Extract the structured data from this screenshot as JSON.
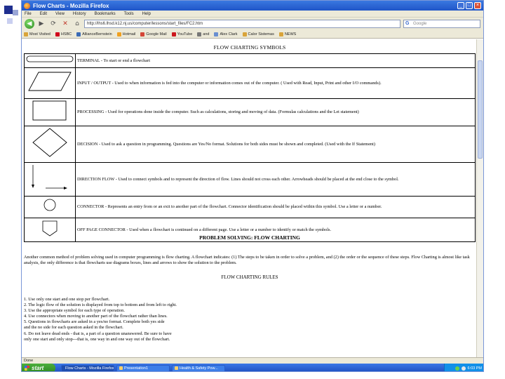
{
  "window": {
    "title": "Flow Charts - Mozilla Firefox",
    "minimize": "_",
    "maximize": "□",
    "close": "×"
  },
  "menu": [
    "File",
    "Edit",
    "View",
    "History",
    "Bookmarks",
    "Tools",
    "Help"
  ],
  "nav": {
    "back": "◀",
    "forward": "▶",
    "reload": "⟳",
    "stop": "✕",
    "home": "⌂",
    "url": "http://lhs6.lhsd.k12.nj.us/computer/lessons/start_files/FC2.htm",
    "search_placeholder": "Google",
    "search_engine_icon": "G"
  },
  "bookmarks": [
    {
      "label": "Most Visited",
      "color": "#d9a43a"
    },
    {
      "label": "HSBC",
      "color": "#d0021b"
    },
    {
      "label": "AllianceBernstein",
      "color": "#3b6bb5"
    },
    {
      "label": "Hotmail",
      "color": "#f0a020"
    },
    {
      "label": "Google Mail",
      "color": "#d44638"
    },
    {
      "label": "YouTube",
      "color": "#cc181e"
    },
    {
      "label": "and",
      "color": "#777777"
    },
    {
      "label": "Alex Clark",
      "color": "#6a8fd0"
    },
    {
      "label": "Calor Sistemas",
      "color": "#d9a43a"
    },
    {
      "label": "NEWS",
      "color": "#d9a43a"
    }
  ],
  "doc": {
    "title": "FLOW CHARTING SYMBOLS",
    "symbols": [
      {
        "shape": "terminal",
        "desc": "TERMINAL - To start or end a flowchart"
      },
      {
        "shape": "parallelogram",
        "desc": "INPUT / OUTPUT - Used to when information is fed into the computer or information comes out of the computer. ( Used with Read, Input, Print and other I/O commands)."
      },
      {
        "shape": "rectangle",
        "desc": "PROCESSING - Used for operations done inside the computer. Such as calculations, storing and moving of data. (Formulas calculations and the Let statement)"
      },
      {
        "shape": "diamond",
        "desc": "DECISION - Used to ask a question in programming. Questions are Yes/No format. Solutions for both sides must be shown and completed. (Used with the If Statement)"
      },
      {
        "shape": "arrows",
        "desc": "DIRECTION FLOW - Used to connect symbols and to represent the direction of flow. Lines should not cross each other. Arrowheads should be placed at the end close to the symbol."
      },
      {
        "shape": "circle",
        "desc": "CONNECTOR - Represents an entry from or an exit to another part of the flowchart. Connector identification should be placed within this symbol. Use a letter or a number."
      },
      {
        "shape": "offpage",
        "desc": "OFF PAGE CONNECTOR - Used when a flowchart is continued on a different page. Use a letter or a number to identify or match the symbols."
      }
    ],
    "section_title": "PROBLEM SOLVING: FLOW CHARTING",
    "paragraph": "Another common method of problem solving used in computer programming is flow charting. A flowchart indicates: (1) The steps to be taken in order to solve a problem, and (2) the order or the sequence of these steps. Flow Charting is almost like task analysis, the only difference is that flowcharts use diagrams boxes, lines and arrows to show the solution to the problem.",
    "rules_title": "FLOW CHARTING RULES",
    "rules": [
      "1. Use only one start and one stop per flowchart.",
      "2. The logic flow of the solution is displayed from top to bottom and from left to right.",
      "3. Use the appropriate symbol for each type of operation.",
      "4. Use connectors when moving to another part of the flowchart rather than lines.",
      "5. Questions in flowcharts are asked in a yes/no format. Complete both yes side",
      "and the no side for each question asked in the flowchart.",
      "6. Do not leave dead ends - that is, a part of a question unanswered. Be sure to have",
      "only one start and only stop---that is, one way in and one way out of the flowchart."
    ]
  },
  "status": "Done",
  "taskbar": {
    "start": "start",
    "tasks": [
      {
        "label": "Flow Charts - Mozilla Firefox",
        "active": true
      },
      {
        "label": "Presentation1",
        "active": false
      },
      {
        "label": "Health & Safety Pow...",
        "active": false
      }
    ],
    "clock": "6:03 PM"
  }
}
